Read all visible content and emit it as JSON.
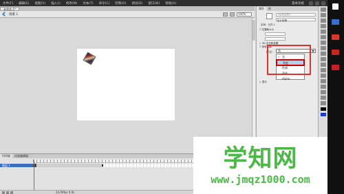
{
  "menubar": {
    "items": [
      "文件(F)",
      "编辑(E)",
      "视图(V)",
      "插入(I)",
      "修改(M)",
      "文本(T)",
      "命令(C)",
      "控制(O)",
      "调试(D)",
      "窗口(W)",
      "帮助(H)"
    ],
    "workspace": "基本功能"
  },
  "document": {
    "tab": "未命名-1*",
    "scene": "场景 1",
    "zoom": "100%"
  },
  "timeline": {
    "tabs": [
      "时间轴",
      "动画编辑器"
    ],
    "layer": "图层 1",
    "fps_text": "24.00fps  0.0s"
  },
  "properties": {
    "tabs": [
      "属性",
      "库"
    ],
    "instance_name": "<实例名称>",
    "instance_type": "影片剪辑",
    "instance_of": "实例：元件 1",
    "section_position": "▽ 位置和大小",
    "section_3d": "▷ 3D 定位和查看",
    "section_color": "▽ 色彩效果",
    "style_label": "样式：",
    "style_value": "无",
    "style_options": [
      {
        "label": "无",
        "selected": false
      },
      {
        "label": "亮度",
        "selected": true
      },
      {
        "label": "色调",
        "selected": false
      },
      {
        "label": "高级",
        "selected": false
      },
      {
        "label": "Alpha",
        "selected": false
      }
    ],
    "section_display": "▷ 显示"
  },
  "watermark": {
    "title": "学知网",
    "url": "www.jmqz1000.com"
  },
  "colors": {
    "highlight_border": "#e03030",
    "watermark_green": "#4cb848",
    "layer_blue": "#3b6fc2"
  }
}
